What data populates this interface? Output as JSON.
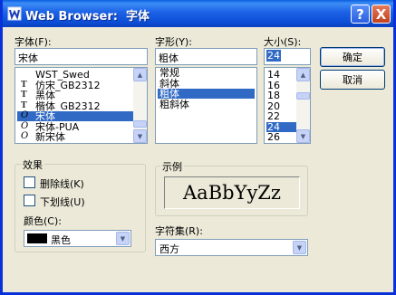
{
  "window": {
    "title": "Web Browser:  字体",
    "help_label": "?",
    "close_label": "X"
  },
  "font_panel": {
    "label": "字体(F):",
    "value": "宋体",
    "items": [
      {
        "label": "WST_Swed",
        "type": "none"
      },
      {
        "label": "仿宋_GB2312",
        "type": "tt"
      },
      {
        "label": "黑体",
        "type": "tt"
      },
      {
        "label": "楷体_GB2312",
        "type": "tt"
      },
      {
        "label": "宋体",
        "type": "o",
        "selected": true
      },
      {
        "label": "宋体-PUA",
        "type": "o"
      },
      {
        "label": "新宋体",
        "type": "o"
      }
    ]
  },
  "style_panel": {
    "label": "字形(Y):",
    "value": "粗体",
    "items": [
      {
        "label": "常规"
      },
      {
        "label": "斜体"
      },
      {
        "label": "粗体",
        "selected": true
      },
      {
        "label": "粗斜体"
      }
    ]
  },
  "size_panel": {
    "label": "大小(S):",
    "value": "24",
    "items": [
      {
        "label": "14"
      },
      {
        "label": "16"
      },
      {
        "label": "18"
      },
      {
        "label": "20"
      },
      {
        "label": "22"
      },
      {
        "label": "24",
        "selected": true
      },
      {
        "label": "26"
      }
    ]
  },
  "buttons": {
    "ok": "确定",
    "cancel": "取消"
  },
  "effects": {
    "title": "效果",
    "strikeout": "删除线(K)",
    "underline": "下划线(U)",
    "color_label": "颜色(C):",
    "color_value": "黑色",
    "color_swatch": "#000000"
  },
  "sample": {
    "title": "示例",
    "text": "AaBbYyZz"
  },
  "charset": {
    "label": "字符集(R):",
    "value": "西方"
  },
  "colors": {
    "titlebar": "#0d4fd8",
    "selection": "#316ac5",
    "dialog_bg": "#ece9d8"
  }
}
